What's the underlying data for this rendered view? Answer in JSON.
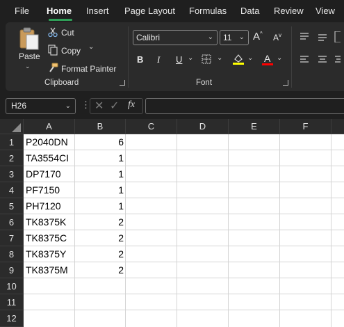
{
  "menu": {
    "items": [
      "File",
      "Home",
      "Insert",
      "Page Layout",
      "Formulas",
      "Data",
      "Review",
      "View"
    ],
    "active": "Home"
  },
  "ribbon": {
    "clipboard": {
      "paste_label": "Paste",
      "cut_label": "Cut",
      "copy_label": "Copy",
      "format_painter_label": "Format Painter",
      "group_label": "Clipboard"
    },
    "font": {
      "font_name": "Calibri",
      "font_size": "11",
      "bold": "B",
      "italic": "I",
      "underline": "U",
      "font_color_letter": "A",
      "grow_font": "A",
      "shrink_font": "A",
      "group_label": "Font"
    },
    "colors": {
      "highlight": "#ffff00",
      "font_color": "#ff0000"
    }
  },
  "formula_bar": {
    "name_box": "H26",
    "fx": "fx",
    "formula": ""
  },
  "sheet": {
    "columns": [
      "A",
      "B",
      "C",
      "D",
      "E",
      "F"
    ],
    "row_numbers": [
      "1",
      "2",
      "3",
      "4",
      "5",
      "6",
      "7",
      "8",
      "9",
      "10",
      "11",
      "12"
    ],
    "rows": [
      {
        "a": "P2040DN",
        "b": "6"
      },
      {
        "a": "TA3554CI",
        "b": "1"
      },
      {
        "a": "DP7170",
        "b": "1"
      },
      {
        "a": "PF7150",
        "b": "1"
      },
      {
        "a": "PH7120",
        "b": "1"
      },
      {
        "a": "TK8375K",
        "b": "2"
      },
      {
        "a": "TK8375C",
        "b": "2"
      },
      {
        "a": "TK8375Y",
        "b": "2"
      },
      {
        "a": "TK8375M",
        "b": "2"
      }
    ]
  }
}
